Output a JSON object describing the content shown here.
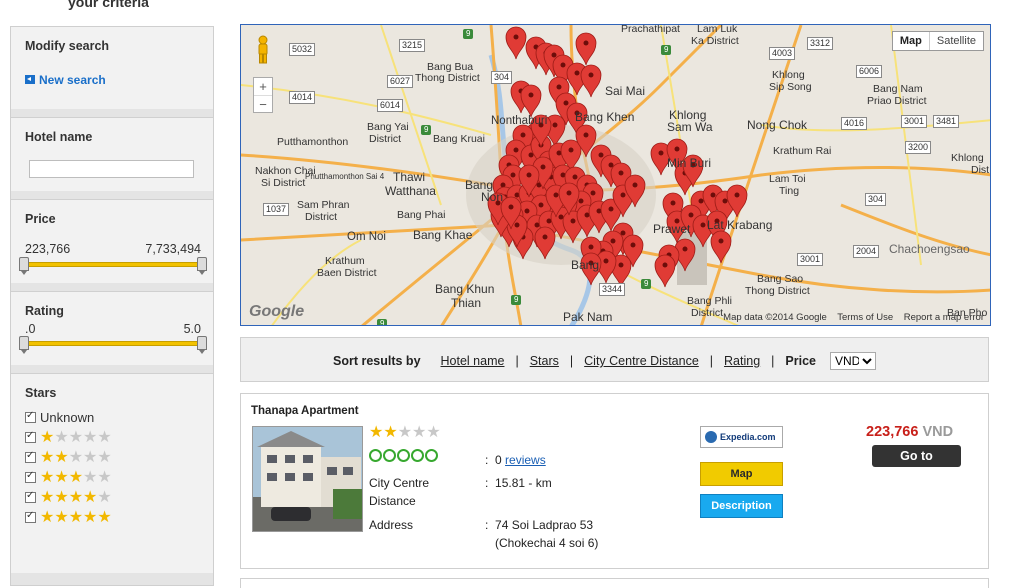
{
  "page": {
    "top_title": "your criteria"
  },
  "sidebar": {
    "modify_search": {
      "title": "Modify search",
      "new_search_label": "New search"
    },
    "hotel_name": {
      "title": "Hotel name",
      "value": ""
    },
    "price": {
      "title": "Price",
      "min_label": "223,766",
      "max_label": "7,733,494",
      "min": 223766,
      "max": 7733494,
      "low": 223766,
      "high": 7733494
    },
    "rating": {
      "title": "Rating",
      "min_label": ".0",
      "max_label": "5.0",
      "low": 0,
      "high": 5
    },
    "stars": {
      "title": "Stars",
      "options": [
        {
          "label": "Unknown",
          "checked": true,
          "stars": 0
        },
        {
          "label": "",
          "checked": true,
          "stars": 1
        },
        {
          "label": "",
          "checked": true,
          "stars": 2
        },
        {
          "label": "",
          "checked": true,
          "stars": 3
        },
        {
          "label": "",
          "checked": true,
          "stars": 4
        },
        {
          "label": "",
          "checked": true,
          "stars": 5
        }
      ]
    }
  },
  "map": {
    "map_type": {
      "map": "Map",
      "satellite": "Satellite",
      "selected": "Map"
    },
    "zoom": {
      "in": "+",
      "out": "−"
    },
    "logo": "Google",
    "footer": {
      "attribution": "Map data ©2014 Google",
      "terms": "Terms of Use",
      "report": "Report a map error"
    },
    "labels": [
      "Prachathipat",
      "Lam Luk",
      "Ka District",
      "Bang Bua",
      "Thong District",
      "Sai Mai",
      "Khlong",
      "Sip Song",
      "Bang Nam",
      "Priao District",
      "Nonthaburi",
      "Bang Yai",
      "District",
      "Bang Kruai",
      "Bang Khen",
      "Khlong",
      "Sam Wa",
      "Nong Chok",
      "Putthamonthon",
      "Krathum Rai",
      "Khlong",
      "Dist",
      "Nakhon Chai",
      "Si District",
      "Bang",
      "Non",
      "Thawi",
      "Watthana",
      "Min Buri",
      "Lam Toi",
      "Ting",
      "Sam Phran",
      "District",
      "Bang Phai",
      "Om Noi",
      "Bang Khae",
      "Prawet",
      "Lat Krabang",
      "Krathum",
      "Baen District",
      "Bang",
      "Chachoengsao",
      "Bang Sao",
      "Thong District",
      "Bang Khun",
      "Thian",
      "Bang Phli",
      "District",
      "Pak Nam",
      "Ban Pho",
      "Phutthamonthon Sai 4"
    ],
    "road_badges": [
      "5032",
      "3215",
      "3312",
      "4003",
      "6006",
      "4014",
      "6027",
      "6014",
      "4016",
      "3001",
      "3481",
      "3200",
      "1037",
      "304",
      "2004",
      "3001",
      "3344",
      "304"
    ],
    "hw_badges": [
      "9",
      "9",
      "9",
      "9",
      "9",
      "9"
    ]
  },
  "sortbar": {
    "label": "Sort results by",
    "options": [
      "Hotel name",
      "Stars",
      "City Centre Distance",
      "Rating"
    ],
    "price_label": "Price",
    "currency": "VND"
  },
  "results": [
    {
      "name": "Thanapa Apartment",
      "stars": 2,
      "review_score_circles": 5,
      "reviews_count": "0",
      "reviews_label": "reviews",
      "distance_label": "City Centre Distance",
      "distance_label_line1": "City Centre",
      "distance_label_line2": "Distance",
      "distance_value": "15.81 - km",
      "address_label": "Address",
      "address_line1": "74 Soi Ladprao 53",
      "address_line2": "(Chokechai 4 soi 6)",
      "provider": "Expedia.com",
      "map_button": "Map",
      "description_button": "Description",
      "price": "223,766",
      "currency": "VND",
      "goto_button": "Go to"
    }
  ],
  "colors": {
    "accent_yellow": "#f1cb00",
    "accent_blue": "#19a9ef",
    "price_red": "#c8201a",
    "pin_red": "#e03b35",
    "map_border": "#2f64b9"
  }
}
